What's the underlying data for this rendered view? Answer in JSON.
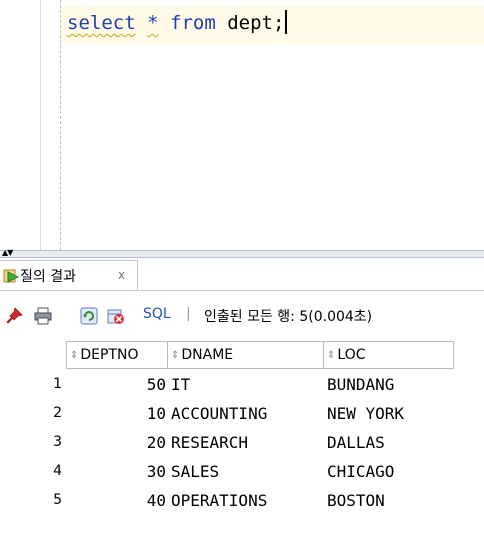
{
  "editor": {
    "code": {
      "kw1": "select",
      "star": "*",
      "kw2": "from",
      "rest": " dept;"
    }
  },
  "results_tab": {
    "label": "질의 결과",
    "close": "x"
  },
  "toolbar": {
    "sql_label": "SQL",
    "separator": "|",
    "status": "인출된 모든 행: 5(0.004초)"
  },
  "grid": {
    "columns": [
      "DEPTNO",
      "DNAME",
      "LOC"
    ],
    "rows": [
      {
        "num": "1",
        "deptno": "50",
        "dname": "IT",
        "loc": "BUNDANG"
      },
      {
        "num": "2",
        "deptno": "10",
        "dname": "ACCOUNTING",
        "loc": "NEW YORK"
      },
      {
        "num": "3",
        "deptno": "20",
        "dname": "RESEARCH",
        "loc": "DALLAS"
      },
      {
        "num": "4",
        "deptno": "30",
        "dname": "SALES",
        "loc": "CHICAGO"
      },
      {
        "num": "5",
        "deptno": "40",
        "dname": "OPERATIONS",
        "loc": "BOSTON"
      }
    ]
  },
  "colors": {
    "keyword": "#1f3fb0",
    "current_line": "#fffbe8",
    "sql_link": "#1f52b3"
  },
  "icons": [
    "run-query-icon",
    "pin-icon",
    "print-icon",
    "refresh-icon",
    "delete-icon",
    "splitter-arrows-icon"
  ]
}
